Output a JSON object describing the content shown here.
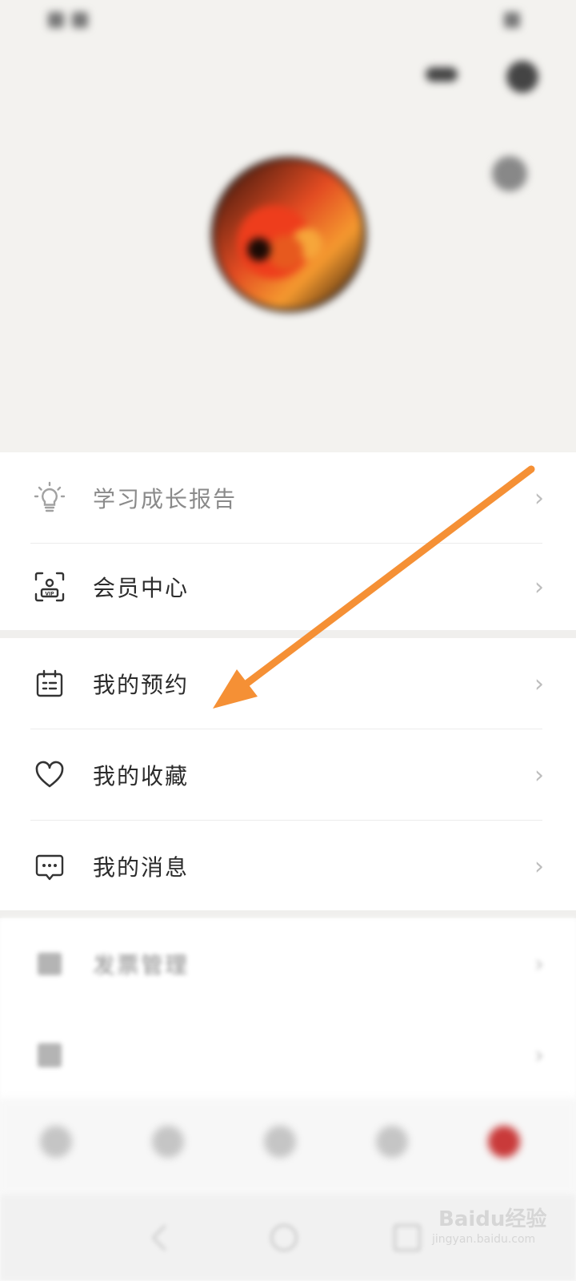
{
  "status_bar": {
    "left": "",
    "right": ""
  },
  "header": {
    "info_line1": "",
    "info_line2": ""
  },
  "profile": {
    "name": "",
    "subtitle": ""
  },
  "menu": {
    "group1": [
      {
        "label": "学习成长报告",
        "icon": "lightbulb-icon",
        "extra": ""
      },
      {
        "label": "会员中心",
        "icon": "vip-card-icon",
        "extra": ""
      }
    ],
    "group2": [
      {
        "label": "我的预约",
        "icon": "calendar-icon"
      },
      {
        "label": "我的收藏",
        "icon": "heart-icon"
      },
      {
        "label": "我的消息",
        "icon": "message-icon"
      }
    ],
    "group3": [
      {
        "label": "发票管理",
        "icon": "invoice-icon"
      },
      {
        "label": "",
        "icon": "grid-icon"
      }
    ]
  },
  "bottom_nav": [
    {
      "label": "",
      "icon": "home-icon",
      "active": false
    },
    {
      "label": "",
      "icon": "discover-icon",
      "active": false
    },
    {
      "label": "",
      "icon": "study-icon",
      "active": false
    },
    {
      "label": "",
      "icon": "community-icon",
      "active": false
    },
    {
      "label": "",
      "icon": "profile-icon",
      "active": true
    }
  ],
  "watermark": {
    "brand": "Baidu经验",
    "url": "jingyan.baidu.com"
  },
  "colors": {
    "accent": "#c93a3a",
    "arrow": "#f59035"
  }
}
